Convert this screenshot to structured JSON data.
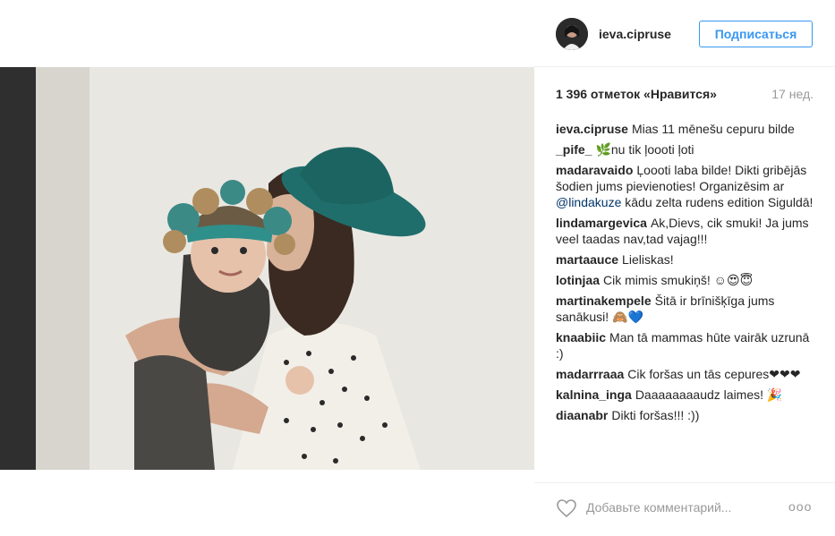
{
  "post": {
    "username": "ieva.cipruse",
    "follow_label": "Подписаться",
    "likes": "1 396 отметок «Нравится»",
    "time_ago": "17 нед.",
    "comment_placeholder": "Добавьте комментарий...",
    "more_label": "ooo"
  },
  "comments": [
    {
      "author": "ieva.cipruse",
      "text": "Mias 11 mēnešu cepuru bilde"
    },
    {
      "author": "_pife_",
      "text": "🌿nu tik ļoooti ļoti"
    },
    {
      "author": "madaravaido",
      "text_before": "Ļoooti laba bilde! Dikti gribējās šodien jums pievienoties! Organizēsim ar ",
      "mention": "@lindakuze",
      "text_after": " kādu zelta rudens edition Siguldā!"
    },
    {
      "author": "lindamargevica",
      "text": "Ak,Dievs, cik smuki! Ja jums veel taadas nav,tad vajag!!!"
    },
    {
      "author": "martaauce",
      "text": "Lieliskas!"
    },
    {
      "author": "lotinjaa",
      "text": "Cik mimis smukiņš! ☺😍😇"
    },
    {
      "author": "martinakempele",
      "text": "Šitā ir brīnišķīga jums sanākusi! 🙈💙"
    },
    {
      "author": "knaabiic",
      "text": "Man tā mammas hūte vairāk uzrunā :)"
    },
    {
      "author": "madarrraaa",
      "text": "Cik foršas un tās cepures❤❤❤"
    },
    {
      "author": "kalnina_inga",
      "text": "Daaaaaaaaudz laimes! 🎉"
    },
    {
      "author": "diaanabr",
      "text": "Dikti foršas!!! :))"
    }
  ],
  "colors": {
    "accent": "#3897f0",
    "text": "#262626",
    "muted": "#999999",
    "mention": "#003569",
    "hat": "#1f6e6b"
  },
  "icons": {
    "like": "heart-icon",
    "more": "more-icon"
  }
}
